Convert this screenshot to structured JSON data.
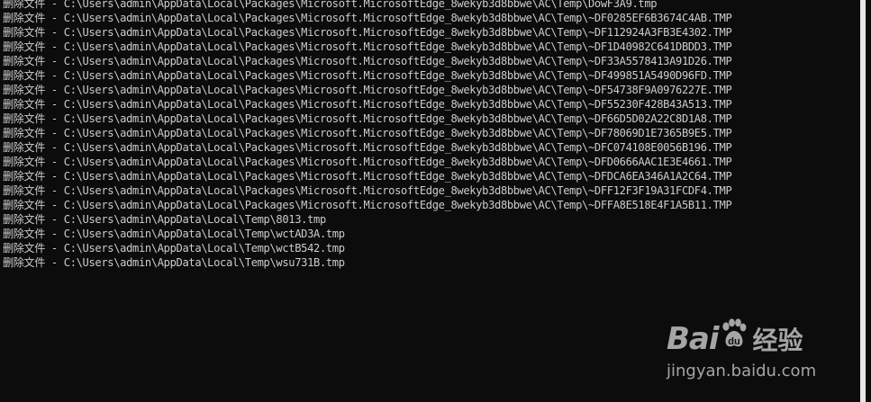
{
  "console": {
    "lines": [
      "删除文件 - C:\\Users\\admin\\AppData\\Local\\Packages\\Microsoft.MicrosoftEdge_8wekyb3d8bbwe\\AC\\Temp\\DowF3A9.tmp",
      "删除文件 - C:\\Users\\admin\\AppData\\Local\\Packages\\Microsoft.MicrosoftEdge_8wekyb3d8bbwe\\AC\\Temp\\~DF0285EF6B3674C4AB.TMP",
      "删除文件 - C:\\Users\\admin\\AppData\\Local\\Packages\\Microsoft.MicrosoftEdge_8wekyb3d8bbwe\\AC\\Temp\\~DF112924A3FB3E4302.TMP",
      "删除文件 - C:\\Users\\admin\\AppData\\Local\\Packages\\Microsoft.MicrosoftEdge_8wekyb3d8bbwe\\AC\\Temp\\~DF1D40982C641DBDD3.TMP",
      "删除文件 - C:\\Users\\admin\\AppData\\Local\\Packages\\Microsoft.MicrosoftEdge_8wekyb3d8bbwe\\AC\\Temp\\~DF33A5578413A91D26.TMP",
      "删除文件 - C:\\Users\\admin\\AppData\\Local\\Packages\\Microsoft.MicrosoftEdge_8wekyb3d8bbwe\\AC\\Temp\\~DF499851A5490D96FD.TMP",
      "删除文件 - C:\\Users\\admin\\AppData\\Local\\Packages\\Microsoft.MicrosoftEdge_8wekyb3d8bbwe\\AC\\Temp\\~DF54738F9A0976227E.TMP",
      "删除文件 - C:\\Users\\admin\\AppData\\Local\\Packages\\Microsoft.MicrosoftEdge_8wekyb3d8bbwe\\AC\\Temp\\~DF55230F428B43A513.TMP",
      "删除文件 - C:\\Users\\admin\\AppData\\Local\\Packages\\Microsoft.MicrosoftEdge_8wekyb3d8bbwe\\AC\\Temp\\~DF66D5D02A22C8D1A8.TMP",
      "删除文件 - C:\\Users\\admin\\AppData\\Local\\Packages\\Microsoft.MicrosoftEdge_8wekyb3d8bbwe\\AC\\Temp\\~DF78069D1E7365B9E5.TMP",
      "删除文件 - C:\\Users\\admin\\AppData\\Local\\Packages\\Microsoft.MicrosoftEdge_8wekyb3d8bbwe\\AC\\Temp\\~DFC074108E0056B196.TMP",
      "删除文件 - C:\\Users\\admin\\AppData\\Local\\Packages\\Microsoft.MicrosoftEdge_8wekyb3d8bbwe\\AC\\Temp\\~DFD0666AAC1E3E4661.TMP",
      "删除文件 - C:\\Users\\admin\\AppData\\Local\\Packages\\Microsoft.MicrosoftEdge_8wekyb3d8bbwe\\AC\\Temp\\~DFDCA6EA346A1A2C64.TMP",
      "删除文件 - C:\\Users\\admin\\AppData\\Local\\Packages\\Microsoft.MicrosoftEdge_8wekyb3d8bbwe\\AC\\Temp\\~DFF12F3F19A31FCDF4.TMP",
      "删除文件 - C:\\Users\\admin\\AppData\\Local\\Packages\\Microsoft.MicrosoftEdge_8wekyb3d8bbwe\\AC\\Temp\\~DFFA8E518E4F1A5B11.TMP",
      "删除文件 - C:\\Users\\admin\\AppData\\Local\\Temp\\8013.tmp",
      "删除文件 - C:\\Users\\admin\\AppData\\Local\\Temp\\wctAD3A.tmp",
      "删除文件 - C:\\Users\\admin\\AppData\\Local\\Temp\\wctB542.tmp",
      "删除文件 - C:\\Users\\admin\\AppData\\Local\\Temp\\wsu731B.tmp"
    ]
  },
  "watermark": {
    "brand_prefix": "Bai",
    "brand_suffix": "经验",
    "url": "jingyan.baidu.com",
    "icon": "paw-icon"
  },
  "colors": {
    "background": "#0c0c0c",
    "text": "#cccccc",
    "watermark": "#d9d9d9"
  }
}
